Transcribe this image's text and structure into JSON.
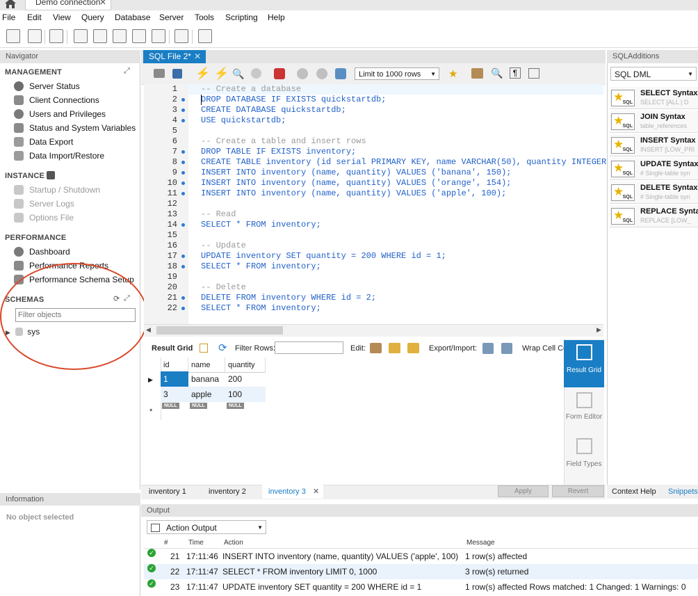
{
  "window": {
    "connection_tab": "Demo connection",
    "close_glyph": "✕"
  },
  "menu": [
    "File",
    "Edit",
    "View",
    "Query",
    "Database",
    "Server",
    "Tools",
    "Scripting",
    "Help"
  ],
  "navigator": {
    "title": "Navigator",
    "management": {
      "label": "MANAGEMENT",
      "items": [
        "Server Status",
        "Client Connections",
        "Users and Privileges",
        "Status and System Variables",
        "Data Export",
        "Data Import/Restore"
      ]
    },
    "instance": {
      "label": "INSTANCE",
      "items": [
        "Startup / Shutdown",
        "Server Logs",
        "Options File"
      ]
    },
    "performance": {
      "label": "PERFORMANCE",
      "items": [
        "Dashboard",
        "Performance Reports",
        "Performance Schema Setup"
      ]
    },
    "schemas": {
      "label": "SCHEMAS",
      "filter_placeholder": "Filter objects",
      "tree": [
        "sys"
      ]
    }
  },
  "information": {
    "title": "Information",
    "empty_text": "No object selected"
  },
  "editor": {
    "tab_label": "SQL File 2*",
    "limit": "Limit to 1000 rows",
    "lines": [
      {
        "n": "1",
        "text": "-- Create a database",
        "type": "cmt",
        "dot": false
      },
      {
        "n": "2",
        "text": "DROP DATABASE IF EXISTS quickstartdb;",
        "type": "kw",
        "dot": true
      },
      {
        "n": "3",
        "text": "CREATE DATABASE quickstartdb;",
        "type": "kw",
        "dot": true
      },
      {
        "n": "4",
        "text": "USE quickstartdb;",
        "type": "kw",
        "dot": true
      },
      {
        "n": "5",
        "text": "",
        "type": "plain",
        "dot": false
      },
      {
        "n": "6",
        "text": "-- Create a table and insert rows",
        "type": "cmt",
        "dot": false
      },
      {
        "n": "7",
        "text": "DROP TABLE IF EXISTS inventory;",
        "type": "kw",
        "dot": true
      },
      {
        "n": "8",
        "text": "CREATE TABLE inventory (id serial PRIMARY KEY, name VARCHAR(50), quantity INTEGER);",
        "type": "kw",
        "dot": true
      },
      {
        "n": "9",
        "text": "INSERT INTO inventory (name, quantity) VALUES ('banana', 150);",
        "type": "kw",
        "dot": true
      },
      {
        "n": "10",
        "text": "INSERT INTO inventory (name, quantity) VALUES ('orange', 154);",
        "type": "kw",
        "dot": true
      },
      {
        "n": "11",
        "text": "INSERT INTO inventory (name, quantity) VALUES ('apple', 100);",
        "type": "kw",
        "dot": true
      },
      {
        "n": "12",
        "text": "",
        "type": "plain",
        "dot": false
      },
      {
        "n": "13",
        "text": "-- Read",
        "type": "cmt",
        "dot": false
      },
      {
        "n": "14",
        "text": "SELECT * FROM inventory;",
        "type": "kw",
        "dot": true
      },
      {
        "n": "15",
        "text": "",
        "type": "plain",
        "dot": false
      },
      {
        "n": "16",
        "text": "-- Update",
        "type": "cmt",
        "dot": false
      },
      {
        "n": "17",
        "text": "UPDATE inventory SET quantity = 200 WHERE id = 1;",
        "type": "kw",
        "dot": true
      },
      {
        "n": "18",
        "text": "SELECT * FROM inventory;",
        "type": "kw",
        "dot": true
      },
      {
        "n": "19",
        "text": "",
        "type": "plain",
        "dot": false
      },
      {
        "n": "20",
        "text": "-- Delete",
        "type": "cmt",
        "dot": false
      },
      {
        "n": "21",
        "text": "DELETE FROM inventory WHERE id = 2;",
        "type": "kw",
        "dot": true
      },
      {
        "n": "22",
        "text": "SELECT * FROM inventory;",
        "type": "kw",
        "dot": true
      }
    ]
  },
  "result_toolbar": {
    "result_grid": "Result Grid",
    "filter_rows": "Filter Rows:",
    "edit": "Edit:",
    "export_import": "Export/Import:",
    "wrap": "Wrap Cell Co"
  },
  "grid": {
    "columns": [
      "id",
      "name",
      "quantity"
    ],
    "rows": [
      [
        "1",
        "banana",
        "200"
      ],
      [
        "3",
        "apple",
        "100"
      ]
    ],
    "null_label": "NULL",
    "new_row_marker": "*"
  },
  "side_tabs": {
    "result_grid": "Result Grid",
    "form_editor": "Form Editor",
    "field_types": "Field Types"
  },
  "result_tabs": {
    "tabs": [
      "inventory 1",
      "inventory 2",
      "inventory 3"
    ],
    "apply": "Apply",
    "revert": "Revert"
  },
  "sql_additions": {
    "title": "SQLAdditions",
    "category": "SQL DML",
    "snippets": [
      {
        "title": "SELECT Syntax",
        "sub": "SELECT    [ALL | D"
      },
      {
        "title": "JOIN Syntax",
        "sub": "table_references"
      },
      {
        "title": "INSERT Syntax",
        "sub": "INSERT [LOW_PRI"
      },
      {
        "title": "UPDATE Syntax",
        "sub": "# Single-table syn"
      },
      {
        "title": "DELETE Syntax",
        "sub": "# Single-table syn"
      },
      {
        "title": "REPLACE Synta",
        "sub": "REPLACE [LOW_"
      }
    ],
    "tabs": [
      "Context Help",
      "Snippets"
    ]
  },
  "output": {
    "title": "Output",
    "mode": "Action Output",
    "headers": [
      "#",
      "Time",
      "Action",
      "Message"
    ],
    "rows": [
      {
        "num": "21",
        "time": "17:11:46",
        "action": "INSERT INTO inventory (name, quantity) VALUES ('apple', 100)",
        "message": "1 row(s) affected"
      },
      {
        "num": "22",
        "time": "17:11:47",
        "action": "SELECT * FROM inventory LIMIT 0, 1000",
        "message": "3 row(s) returned"
      },
      {
        "num": "23",
        "time": "17:11:47",
        "action": "UPDATE inventory SET quantity = 200 WHERE id = 1",
        "message": "1 row(s) affected Rows matched: 1  Changed: 1  Warnings: 0"
      }
    ]
  },
  "colors": {
    "accent": "#1a7ec4",
    "keyword": "#2161c9",
    "comment": "#9a9a9a",
    "annotation": "#d94a2c",
    "ok": "#2aa335"
  }
}
